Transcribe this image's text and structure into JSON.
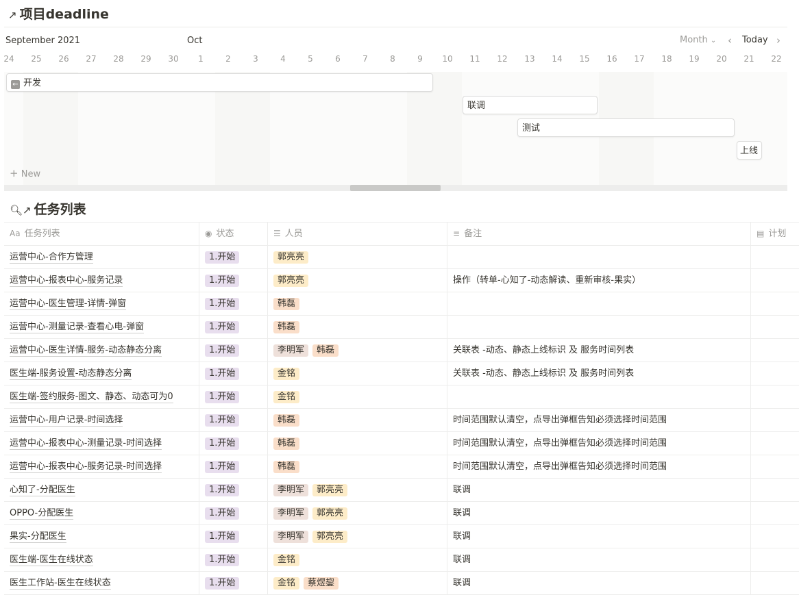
{
  "timeline": {
    "title": "项目deadline",
    "month_primary": "September 2021",
    "month_secondary": "Oct",
    "view_label": "Month",
    "today_label": "Today",
    "days": [
      "24",
      "25",
      "26",
      "27",
      "28",
      "29",
      "30",
      "1",
      "2",
      "3",
      "4",
      "5",
      "6",
      "7",
      "8",
      "9",
      "10",
      "11",
      "12",
      "13",
      "14",
      "15",
      "16",
      "17",
      "18",
      "19",
      "20",
      "21",
      "22"
    ],
    "bars": [
      {
        "label": "开发"
      },
      {
        "label": "联调"
      },
      {
        "label": "测试"
      },
      {
        "label": "上线"
      }
    ],
    "new_label": "New"
  },
  "tasks": {
    "title": "任务列表",
    "columns": [
      "任务列表",
      "状态",
      "人员",
      "备注",
      "计划"
    ],
    "colors": {
      "status_bg": "#e8deee",
      "person_orange_bg": "#fadec9",
      "person_yellow_bg": "#fdecc8",
      "person_brown_bg": "#eee0da"
    },
    "rows": [
      {
        "name": "运营中心-合作方管理",
        "status": "1.开始",
        "people": [
          "郭亮亮"
        ],
        "note": ""
      },
      {
        "name": "运营中心-报表中心-服务记录",
        "status": "1.开始",
        "people": [
          "郭亮亮"
        ],
        "note": "操作（转单-心知了-动态解读、重新审核-果实）"
      },
      {
        "name": "运营中心-医生管理-详情-弹窗",
        "status": "1.开始",
        "people": [
          "韩磊"
        ],
        "note": ""
      },
      {
        "name": "运营中心-测量记录-查看心电-弹窗",
        "status": "1.开始",
        "people": [
          "韩磊"
        ],
        "note": ""
      },
      {
        "name": "运营中心-医生详情-服务-动态静态分离",
        "status": "1.开始",
        "people": [
          "李明军",
          "韩磊"
        ],
        "note": "关联表 -动态、静态上线标识  及 服务时间列表"
      },
      {
        "name": "医生端-服务设置-动态静态分离",
        "status": "1.开始",
        "people": [
          "金铭"
        ],
        "note": "关联表 -动态、静态上线标识  及 服务时间列表"
      },
      {
        "name": "医生端-签约服务-图文、静态、动态可为0",
        "status": "1.开始",
        "people": [
          "金铭"
        ],
        "note": ""
      },
      {
        "name": "运营中心-用户记录-时间选择",
        "status": "1.开始",
        "people": [
          "韩磊"
        ],
        "note": "时间范围默认清空，点导出弹框告知必须选择时间范围"
      },
      {
        "name": "运营中心-报表中心-测量记录-时间选择",
        "status": "1.开始",
        "people": [
          "韩磊"
        ],
        "note": "时间范围默认清空，点导出弹框告知必须选择时间范围"
      },
      {
        "name": "运营中心-报表中心-服务记录-时间选择",
        "status": "1.开始",
        "people": [
          "韩磊"
        ],
        "note": "时间范围默认清空，点导出弹框告知必须选择时间范围"
      },
      {
        "name": "心知了-分配医生",
        "status": "1.开始",
        "people": [
          "李明军",
          "郭亮亮"
        ],
        "note": "联调"
      },
      {
        "name": "OPPO-分配医生",
        "status": "1.开始",
        "people": [
          "李明军",
          "郭亮亮"
        ],
        "note": "联调"
      },
      {
        "name": "果实-分配医生",
        "status": "1.开始",
        "people": [
          "李明军",
          "郭亮亮"
        ],
        "note": "联调"
      },
      {
        "name": "医生端-医生在线状态",
        "status": "1.开始",
        "people": [
          "金铭"
        ],
        "note": "联调"
      },
      {
        "name": "医生工作站-医生在线状态",
        "status": "1.开始",
        "people": [
          "金铭",
          "蔡煜鋆"
        ],
        "note": "联调"
      }
    ]
  }
}
